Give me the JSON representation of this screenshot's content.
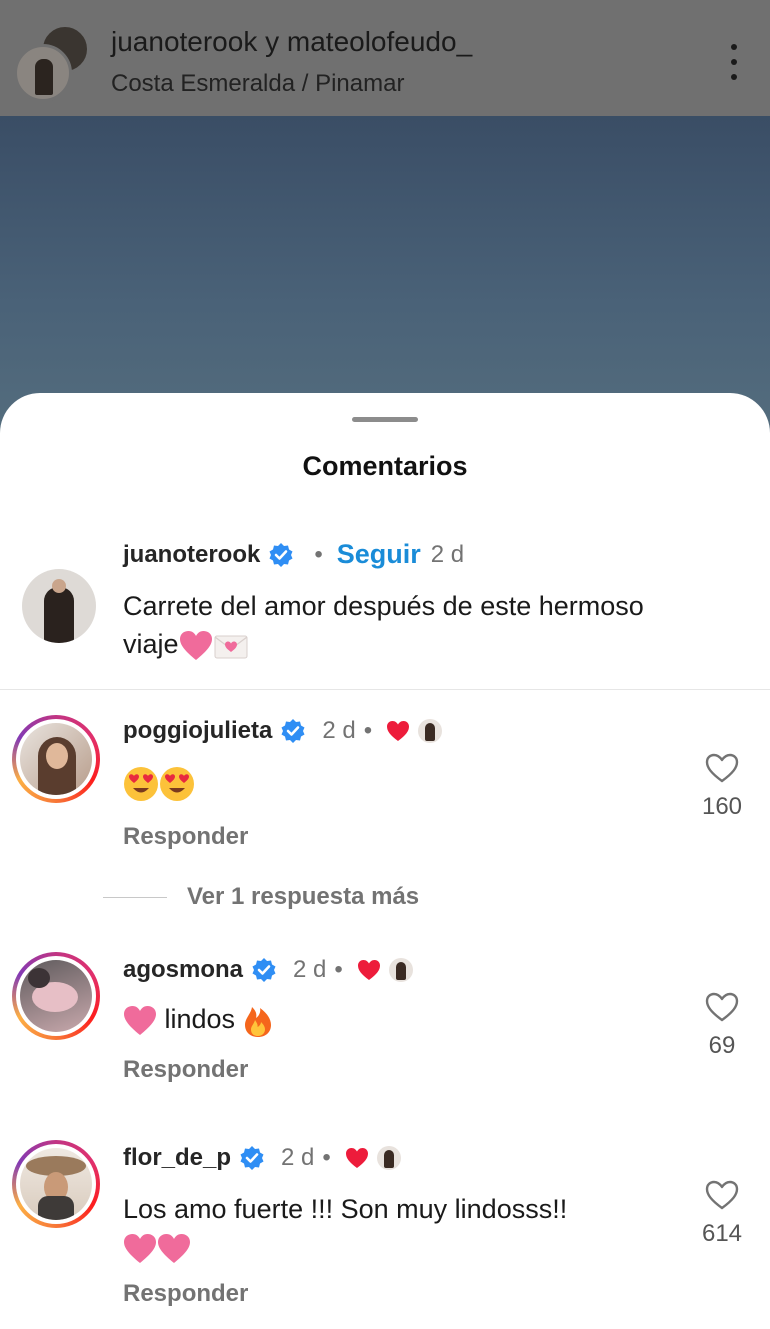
{
  "header": {
    "users": "juanoterook y mateolofeudo_",
    "location": "Costa Esmeralda / Pinamar"
  },
  "sheet": {
    "title": "Comentarios"
  },
  "caption": {
    "username": "juanoterook",
    "follow_label": "Seguir",
    "time": "2 d",
    "text": "Carrete del amor después de este hermoso",
    "text_line2": "viaje"
  },
  "comments": [
    {
      "username": "poggiojulieta",
      "time": "2 d",
      "text": "",
      "reply_label": "Responder",
      "likes": "160"
    },
    {
      "username": "agosmona",
      "time": "2 d",
      "text": "lindos",
      "reply_label": "Responder",
      "likes": "69"
    },
    {
      "username": "flor_de_p",
      "time": "2 d",
      "text": "Los amo fuerte !!! Son muy lindosss!!",
      "reply_label": "Responder",
      "likes": "614"
    }
  ],
  "view_more_replies": "Ver 1 respuesta más",
  "colors": {
    "accent_link": "#1a8cd8",
    "verified": "#2f8ef4",
    "heart_red": "#ed1c3b",
    "pink_heart": "#f06b9b"
  },
  "icons": [
    "more-options-icon",
    "verified-badge-icon",
    "heart-outline-icon",
    "red-heart-icon",
    "heart-eyes-emoji",
    "fire-emoji",
    "love-letter-emoji",
    "pink-heart-emoji"
  ]
}
